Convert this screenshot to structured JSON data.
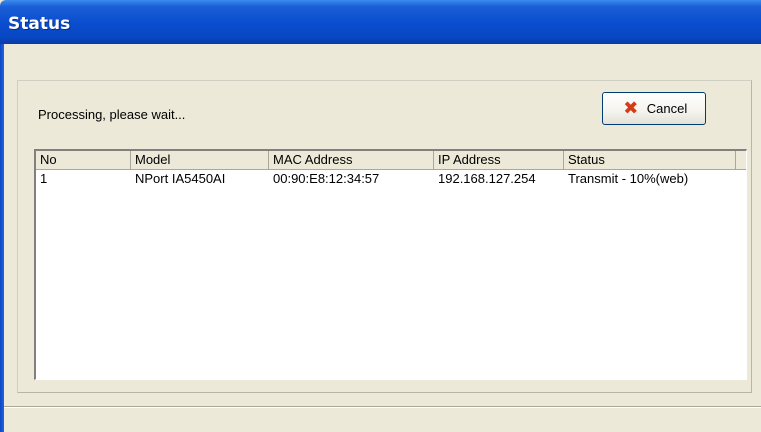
{
  "window": {
    "title": "Status"
  },
  "message": "Processing, please wait...",
  "cancel_button": {
    "label": "Cancel",
    "icon": "x-icon",
    "icon_color": "#d83b14"
  },
  "list": {
    "columns": [
      "No",
      "Model",
      "MAC Address",
      "IP Address",
      "Status"
    ],
    "rows": [
      [
        "1",
        "NPort IA5450AI",
        "00:90:E8:12:34:57",
        "192.168.127.254",
        "Transmit - 10%(web)"
      ]
    ]
  },
  "colors": {
    "titlebar": "#0a4ccf",
    "dialog_bg": "#ece9d8"
  }
}
